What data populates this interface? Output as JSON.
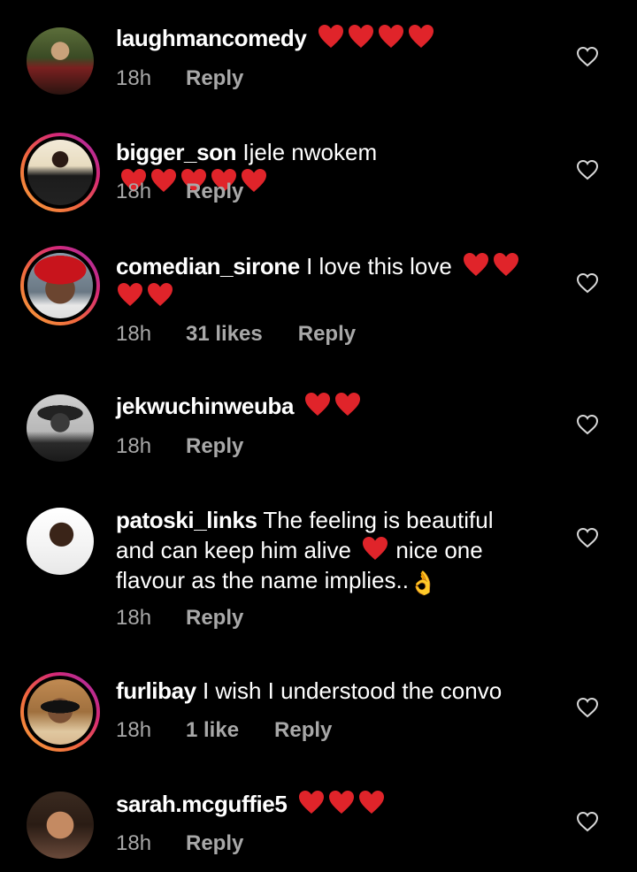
{
  "colors": {
    "background": "#000000",
    "text": "#ffffff",
    "meta": "#a8a8a8",
    "heart": "#e0242a",
    "story_ring": "#f0653f"
  },
  "comments": [
    {
      "username": "laughmancomedy",
      "text": "",
      "hearts": 4,
      "time": "18h",
      "likes": "",
      "reply": "Reply",
      "story_ring": false
    },
    {
      "username": "bigger_son",
      "text": "Ijele nwokem",
      "hearts": 5,
      "time": "18h",
      "likes": "",
      "reply": "Reply",
      "story_ring": true
    },
    {
      "username": "comedian_sirone",
      "text": "I love this love",
      "hearts": 4,
      "time": "18h",
      "likes": "31 likes",
      "reply": "Reply",
      "story_ring": true
    },
    {
      "username": "jekwuchinweuba",
      "text": "",
      "hearts": 2,
      "time": "18h",
      "likes": "",
      "reply": "Reply",
      "story_ring": false
    },
    {
      "username": "patoski_links",
      "text": "The feeling is beautiful and can keep him alive",
      "text_after_heart": "nice one flavour as the name implies..",
      "emoji": "👌",
      "hearts": 1,
      "time": "18h",
      "likes": "",
      "reply": "Reply",
      "story_ring": false
    },
    {
      "username": "furlibay",
      "text": "I wish I understood the convo",
      "hearts": 0,
      "time": "18h",
      "likes": "1 like",
      "reply": "Reply",
      "story_ring": true
    },
    {
      "username": "sarah.mcguffie5",
      "text": "",
      "hearts": 3,
      "time": "18h",
      "likes": "",
      "reply": "Reply",
      "story_ring": false
    }
  ]
}
